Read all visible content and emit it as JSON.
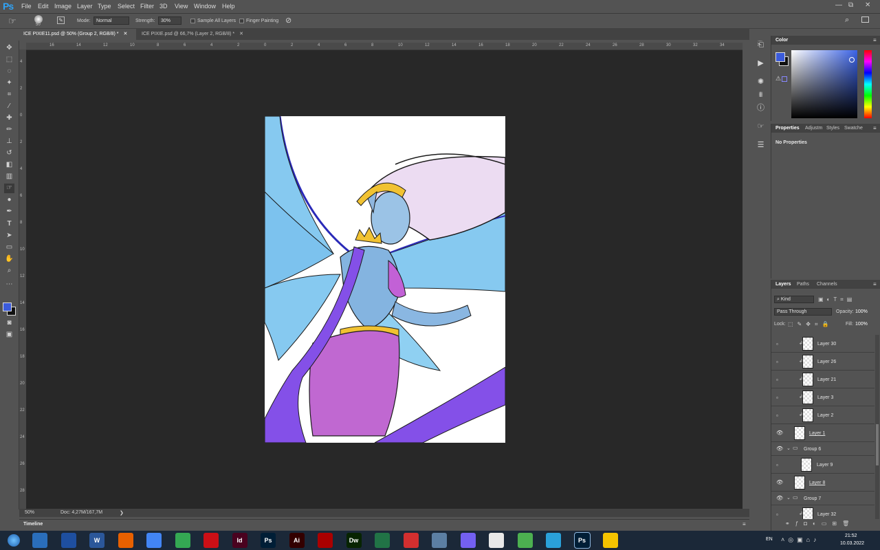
{
  "app": {
    "logo": "Ps",
    "menu": [
      "File",
      "Edit",
      "Image",
      "Layer",
      "Type",
      "Select",
      "Filter",
      "3D",
      "View",
      "Window",
      "Help"
    ],
    "window_controls": [
      "—",
      "⧉",
      "✕"
    ]
  },
  "options_bar": {
    "brush_size": "50",
    "mode_label": "Mode:",
    "mode_value": "Normal",
    "strength_label": "Strength:",
    "strength_value": "30%",
    "sample_all_layers": "Sample All Layers",
    "finger_painting": "Finger Painting"
  },
  "tabs": [
    {
      "label": "ICE PIXIE11.psd @ 50% (Group 2, RGB/8) *",
      "active": true
    },
    {
      "label": "ICE PIXIE.psd @ 66,7% (Layer 2, RGB/8) *",
      "active": false
    }
  ],
  "ruler_top": [
    "16",
    "14",
    "12",
    "10",
    "8",
    "6",
    "4",
    "2",
    "0",
    "2",
    "4",
    "6",
    "8",
    "10",
    "12",
    "14",
    "16",
    "18",
    "20",
    "22",
    "24",
    "26",
    "28",
    "30",
    "32",
    "34"
  ],
  "ruler_left": [
    "4",
    "2",
    "0",
    "2",
    "4",
    "6",
    "8",
    "10",
    "12",
    "14",
    "16",
    "18",
    "20",
    "22",
    "24",
    "26",
    "28",
    "30",
    "32",
    "34"
  ],
  "status": {
    "zoom": "50%",
    "doc": "Doc: 4,27M/167,7M",
    "arrow": "❯"
  },
  "timeline": {
    "label": "Timeline"
  },
  "color_panel": {
    "title": "Color",
    "fg_color": "#3b5bdb",
    "bg_color": "#111111"
  },
  "properties_panel": {
    "tabs": [
      "Properties",
      "Adjustm",
      "Styles",
      "Swatche"
    ],
    "content": "No Properties"
  },
  "layers_panel": {
    "tabs": [
      "Layers",
      "Paths",
      "Channels"
    ],
    "filter_value": "Kind",
    "blend_mode": "Pass Through",
    "opacity_label": "Opacity:",
    "opacity_value": "100%",
    "lock_label": "Lock:",
    "fill_label": "Fill:",
    "fill_value": "100%",
    "layers": [
      {
        "name": "Layer 30",
        "visible": false,
        "clipped": true,
        "group": false
      },
      {
        "name": "Layer 26",
        "visible": false,
        "clipped": true,
        "group": false
      },
      {
        "name": "Layer 21",
        "visible": false,
        "clipped": true,
        "group": false
      },
      {
        "name": "Layer 3",
        "visible": false,
        "clipped": true,
        "group": false
      },
      {
        "name": "Layer 2",
        "visible": false,
        "clipped": true,
        "group": false
      },
      {
        "name": "Layer 1",
        "visible": true,
        "clipped": false,
        "group": false
      },
      {
        "name": "Group 6",
        "visible": true,
        "clipped": false,
        "group": true
      },
      {
        "name": "Layer 9",
        "visible": false,
        "clipped": false,
        "group": false
      },
      {
        "name": "Layer 8",
        "visible": true,
        "clipped": false,
        "group": false
      },
      {
        "name": "Group 7",
        "visible": true,
        "clipped": false,
        "group": true
      },
      {
        "name": "Layer 32",
        "visible": false,
        "clipped": true,
        "group": false
      }
    ],
    "footer_icons": [
      "link-icon",
      "fx-icon",
      "mask-icon",
      "adjustment-icon",
      "folder-icon",
      "new-layer-icon",
      "trash-icon"
    ]
  },
  "taskbar": {
    "apps": [
      {
        "name": "explorer-icon",
        "label": "",
        "color": "#2a6ebb"
      },
      {
        "name": "save-icon",
        "label": "",
        "color": "#1e4fa0"
      },
      {
        "name": "word-icon",
        "label": "W",
        "color": "#2b579a"
      },
      {
        "name": "firefox-icon",
        "label": "",
        "color": "#e66000"
      },
      {
        "name": "chrome-icon",
        "label": "",
        "color": "#4285f4"
      },
      {
        "name": "chrome-icon-2",
        "label": "",
        "color": "#34a853"
      },
      {
        "name": "opera-icon",
        "label": "",
        "color": "#cc0f16"
      },
      {
        "name": "indesign-icon",
        "label": "Id",
        "color": "#49021f"
      },
      {
        "name": "photoshop-icon",
        "label": "Ps",
        "color": "#001e36"
      },
      {
        "name": "illustrator-icon",
        "label": "Ai",
        "color": "#330000"
      },
      {
        "name": "acrobat-icon",
        "label": "",
        "color": "#a00"
      },
      {
        "name": "dreamweaver-icon",
        "label": "Dw",
        "color": "#072401"
      },
      {
        "name": "excel-icon",
        "label": "",
        "color": "#217346"
      },
      {
        "name": "pdf-icon",
        "label": "",
        "color": "#d32f2f"
      },
      {
        "name": "calculator-icon",
        "label": "",
        "color": "#5c7fa3"
      },
      {
        "name": "viber-icon",
        "label": "",
        "color": "#7360f2"
      },
      {
        "name": "hourglass-icon",
        "label": "",
        "color": "#e8e8e8"
      },
      {
        "name": "bluestacks-icon",
        "label": "",
        "color": "#4caf50"
      },
      {
        "name": "telegram-icon",
        "label": "",
        "color": "#2aa1da"
      },
      {
        "name": "photoshop-active-icon",
        "label": "Ps",
        "color": "#001e36"
      },
      {
        "name": "batman-icon",
        "label": "",
        "color": "#f5c400"
      }
    ],
    "language": "EN",
    "time": "21:52",
    "date": "10.03.2022"
  }
}
